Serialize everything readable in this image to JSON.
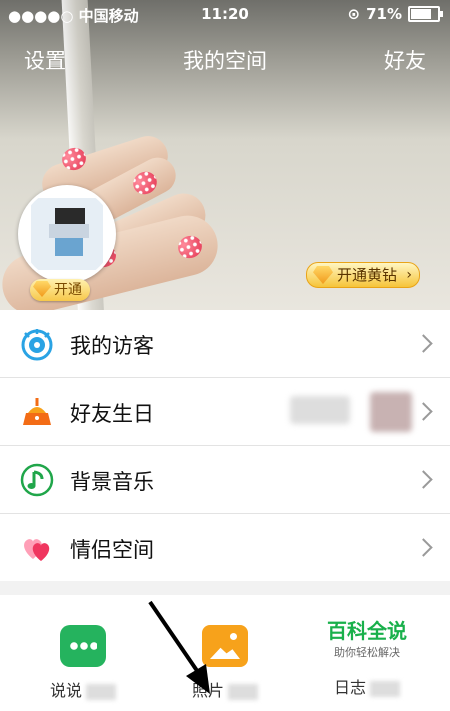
{
  "status_bar": {
    "carrier": "●●●●○ 中国移动",
    "time": "11:20",
    "battery": "71%"
  },
  "nav": {
    "left": "设置",
    "title": "我的空间",
    "right": "好友"
  },
  "profile": {
    "open_badge": "开通",
    "yellow_diamond_button": "开通黄钻"
  },
  "menu": {
    "items": [
      {
        "label": "我的访客",
        "icon": "eye-icon"
      },
      {
        "label": "好友生日",
        "icon": "cake-icon"
      },
      {
        "label": "背景音乐",
        "icon": "music-note-icon"
      },
      {
        "label": "情侣空间",
        "icon": "hearts-icon"
      }
    ]
  },
  "tabs": {
    "items": [
      {
        "label": "说说",
        "icon": "chat-bubble-icon"
      },
      {
        "label": "照片",
        "icon": "photo-icon"
      },
      {
        "label": "日志",
        "icon": "journal-icon"
      }
    ],
    "watermark_title": "百科全说",
    "watermark_sub": "助你轻松解决"
  },
  "colors": {
    "accent_green": "#25b35e",
    "accent_orange": "#f7a21b",
    "menu_icon_blue": "#2aa3e4",
    "gold": "#f6c43a"
  }
}
